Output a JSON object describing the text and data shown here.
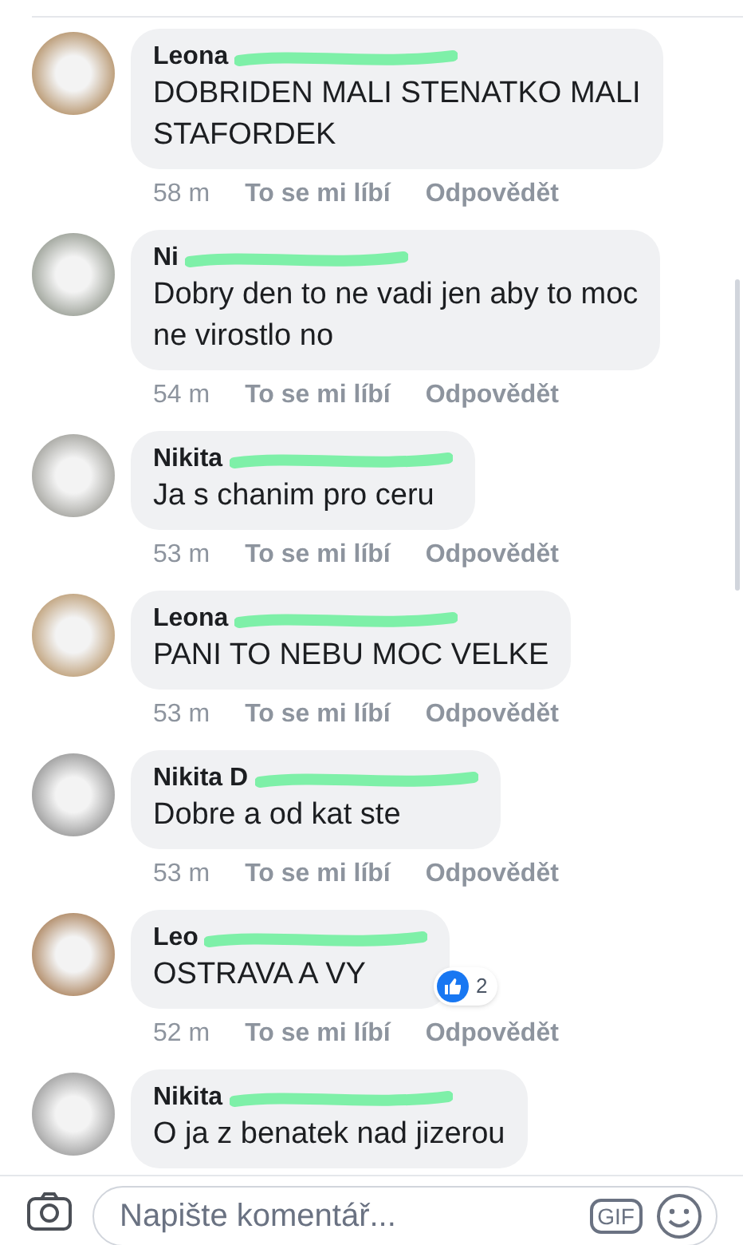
{
  "comments": [
    {
      "author": "Leona",
      "lines": [
        "DOBRIDEN MALI STENATKO MALI",
        "STAFORDEK"
      ],
      "time": "58 m",
      "like": "To se mi líbí",
      "reply": "Odpovědět"
    },
    {
      "author": "Ni",
      "lines": [
        "Dobry den to ne vadi jen aby to moc",
        "ne virostlo no"
      ],
      "time": "54 m",
      "like": "To se mi líbí",
      "reply": "Odpovědět"
    },
    {
      "author": "Nikita",
      "lines": [
        "Ja s chanim pro ceru"
      ],
      "time": "53 m",
      "like": "To se mi líbí",
      "reply": "Odpovědět"
    },
    {
      "author": "Leona",
      "lines": [
        "PANI TO NEBU MOC VELKE"
      ],
      "time": "53 m",
      "like": "To se mi líbí",
      "reply": "Odpovědět"
    },
    {
      "author": "Nikita D",
      "lines": [
        "Dobre a od kat ste"
      ],
      "time": "53 m",
      "like": "To se mi líbí",
      "reply": "Odpovědět"
    },
    {
      "author": "Leo",
      "lines": [
        "OSTRAVA A VY"
      ],
      "time": "52 m",
      "like": "To se mi líbí",
      "reply": "Odpovědět",
      "reactions": "2"
    },
    {
      "author": "Nikita",
      "lines": [
        "O ja z benatek nad jizerou"
      ]
    }
  ],
  "composer": {
    "placeholder": "Napište komentář...",
    "gif": "GIF"
  }
}
